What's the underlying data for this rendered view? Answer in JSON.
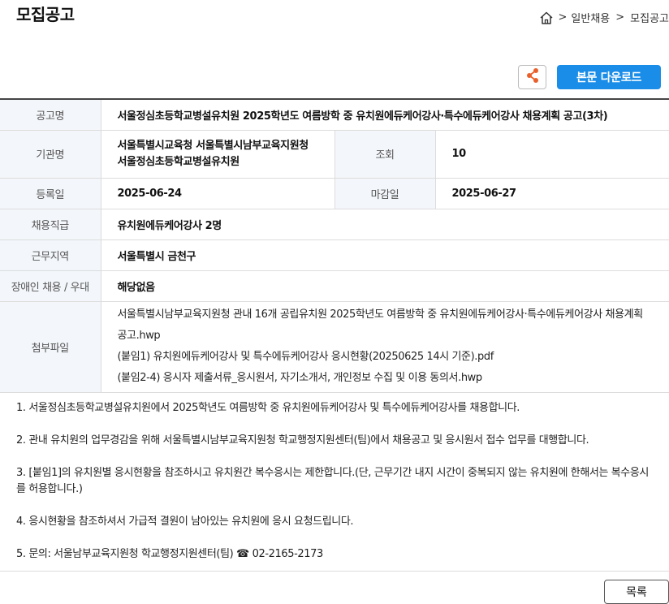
{
  "header": {
    "title": "모집공고",
    "breadcrumb": [
      ">",
      "일반채용",
      ">",
      "모집공고"
    ]
  },
  "toolbar": {
    "download_label": "본문 다운로드"
  },
  "info": {
    "notice_name_label": "공고명",
    "notice_name": "서울정심초등학교병설유치원 2025학년도 여름방학 중 유치원에듀케어강사·특수에듀케어강사 채용계획 공고(3차)",
    "agency_label": "기관명",
    "agency": "서울특별시교육청 서울특별시남부교육지원청 서울정심초등학교병설유치원",
    "views_label": "조회",
    "views": "10",
    "reg_date_label": "등록일",
    "reg_date": "2025-06-24",
    "deadline_label": "마감일",
    "deadline": "2025-06-27",
    "job_label": "채용직급",
    "job": "유치원에듀케어강사 2명",
    "region_label": "근무지역",
    "region": "서울특별시 금천구",
    "disabled_label": "장애인 채용 / 우대",
    "disabled": "해당없음",
    "attach_label": "첨부파일",
    "attachments": [
      "서울특별시남부교육지원청 관내 16개 공립유치원 2025학년도 여름방학 중 유치원에듀케어강사·특수에듀케어강사 채용계획 공고.hwp",
      "(붙임1) 유치원에듀케어강사 및 특수에듀케어강사 응시현황(20250625 14시 기준).pdf",
      "(붙임2-4) 응시자 제출서류_응시원서, 자기소개서, 개인정보 수집 및 이용 동의서.hwp"
    ]
  },
  "body": {
    "paragraphs": [
      "1. 서울정심초등학교병설유치원에서 2025학년도 여름방학 중 유치원에듀케어강사 및 특수에듀케어강사를 채용합니다.",
      "2. 관내 유치원의 업무경감을 위해 서울특별시남부교육지원청 학교행정지원센터(팀)에서 채용공고 및 응시원서 접수 업무를 대행합니다.",
      "3. [붙임1]의 유치원별 응시현황을 참조하시고 유치원간 복수응시는 제한합니다.(단, 근무기간 내지 시간이 중복되지 않는 유치원에 한해서는 복수응시를 허용합니다.)",
      "4. 응시현황을 참조하셔서 가급적 결원이 남아있는 유치원에 응시 요청드립니다.",
      "5. 문의: 서울남부교육지원청 학교행정지원센터(팀) ☎ 02-2165-2173"
    ]
  },
  "footer": {
    "list_label": "목록"
  },
  "colors": {
    "accent": "#1a8de8",
    "share_icon": "#e8612c",
    "header_cell_bg": "#f3f6fa"
  }
}
